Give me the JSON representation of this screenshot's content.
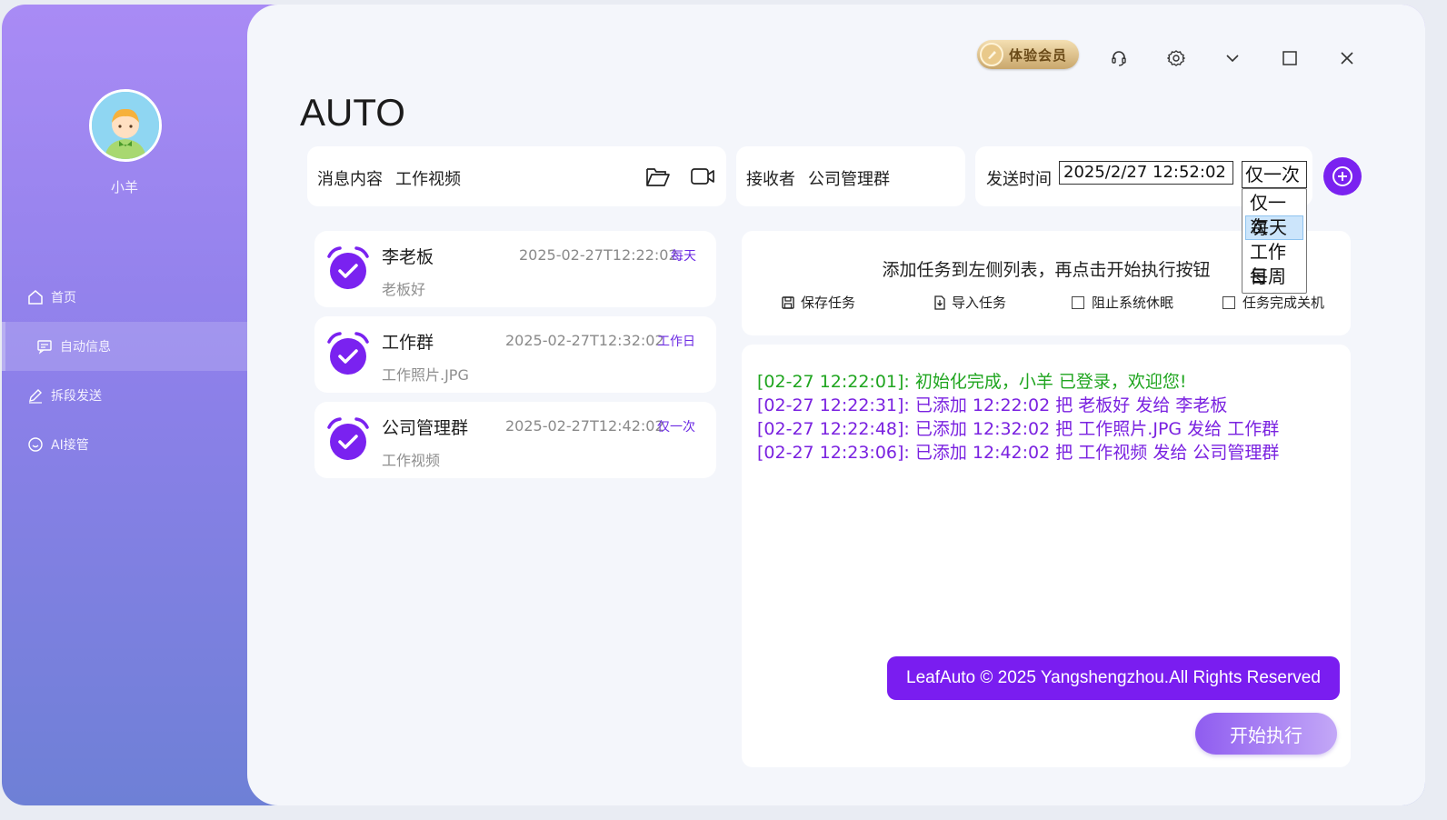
{
  "sidebar": {
    "username": "小羊",
    "items": [
      {
        "label": "首页",
        "icon": "home-icon"
      },
      {
        "label": "自动信息",
        "icon": "message-icon",
        "active": true
      },
      {
        "label": "拆段发送",
        "icon": "edit-icon"
      },
      {
        "label": "AI接管",
        "icon": "smile-icon"
      }
    ]
  },
  "topbar": {
    "vip_label": "体验会员",
    "icons": [
      "headset-icon",
      "settings-icon",
      "chevron-down-icon",
      "maximize-icon",
      "close-icon"
    ]
  },
  "page_title": "AUTO",
  "form": {
    "message_label": "消息内容",
    "message_value": "工作视频",
    "receiver_label": "接收者",
    "receiver_value": "公司管理群",
    "time_label": "发送时间",
    "time_value": "2025/2/27 12:52:02",
    "repeat_value": "仅一次",
    "repeat_options": [
      "仅一次",
      "每天",
      "工作日",
      "每周"
    ],
    "repeat_highlighted": "每天"
  },
  "tasks": [
    {
      "name": "李老板",
      "time": "2025-02-27T12:22:02",
      "repeat": "每天",
      "content": "老板好"
    },
    {
      "name": "工作群",
      "time": "2025-02-27T12:32:02",
      "repeat": "工作日",
      "content": "工作照片.JPG"
    },
    {
      "name": "公司管理群",
      "time": "2025-02-27T12:42:02",
      "repeat": "仅一次",
      "content": "工作视频"
    }
  ],
  "panel": {
    "hint": "添加任务到左侧列表，再点击开始执行按钮",
    "save_label": "保存任务",
    "import_label": "导入任务",
    "prevent_sleep_label": "阻止系统休眠",
    "shutdown_label": "任务完成关机"
  },
  "logs": [
    {
      "text": "[02-27 12:22:01]: 初始化完成，小羊 已登录，欢迎您!",
      "color": "#1fa51f"
    },
    {
      "text": "[02-27 12:22:31]: 已添加 12:22:02 把 老板好 发给 李老板",
      "color": "#7a22e0"
    },
    {
      "text": "[02-27 12:22:48]: 已添加 12:32:02 把 工作照片.JPG 发给 工作群",
      "color": "#7a22e0"
    },
    {
      "text": "[02-27 12:23:06]: 已添加 12:42:02 把 工作视频 发给 公司管理群",
      "color": "#7a22e0"
    }
  ],
  "copyright": "LeafAuto © 2025 Yangshengzhou.All Rights Reserved",
  "start_label": "开始执行",
  "colors": {
    "accent": "#7a22f0",
    "sidebar_top": "#a98bf5",
    "sidebar_bottom": "#6e80d6"
  }
}
